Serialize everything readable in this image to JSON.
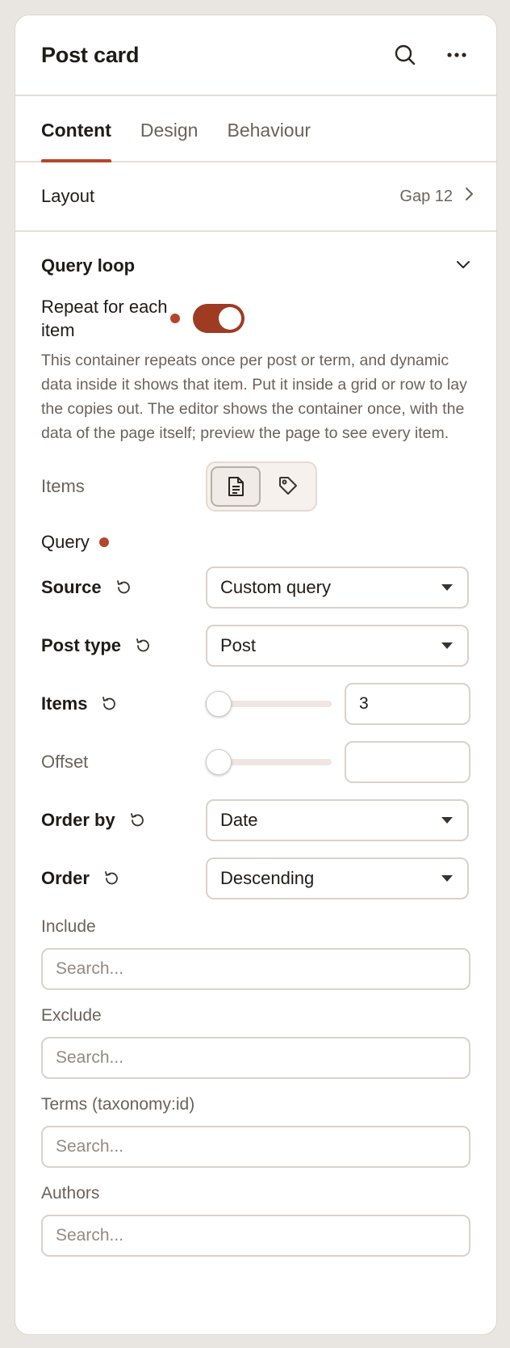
{
  "panel": {
    "title": "Post card",
    "icons": {
      "search": "search-icon",
      "more": "more-horizontal-icon"
    }
  },
  "tabs": [
    {
      "label": "Content",
      "active": true
    },
    {
      "label": "Design",
      "active": false
    },
    {
      "label": "Behaviour",
      "active": false
    }
  ],
  "layout": {
    "label": "Layout",
    "value": "Gap 12"
  },
  "query_loop": {
    "title": "Query loop",
    "repeat": {
      "label": "Repeat for each item",
      "enabled": true,
      "description": "This container repeats once per post or term, and dynamic data inside it shows that item. Put it inside a grid or row to lay the copies out. The editor shows the container once, with the data of the page itself; preview the page to see every item."
    },
    "items_type": {
      "label": "Items",
      "options": [
        "post-document-icon",
        "term-tag-icon"
      ],
      "selected": 0
    },
    "query_heading": "Query",
    "source": {
      "label": "Source",
      "value": "Custom query"
    },
    "post_type": {
      "label": "Post type",
      "value": "Post"
    },
    "items_count": {
      "label": "Items",
      "value": "3",
      "slider_fraction": 0.0
    },
    "offset": {
      "label": "Offset",
      "value": "",
      "slider_fraction": 0.0
    },
    "order_by": {
      "label": "Order by",
      "value": "Date"
    },
    "order": {
      "label": "Order",
      "value": "Descending"
    },
    "include": {
      "label": "Include",
      "placeholder": "Search..."
    },
    "exclude": {
      "label": "Exclude",
      "placeholder": "Search..."
    },
    "terms": {
      "label": "Terms (taxonomy:id)",
      "placeholder": "Search..."
    },
    "authors": {
      "label": "Authors",
      "placeholder": "Search..."
    }
  },
  "colors": {
    "accent": "#b5462b",
    "toggle_on": "#9e3b22",
    "muted_text": "#6b625c",
    "border": "#d9d2cc"
  }
}
